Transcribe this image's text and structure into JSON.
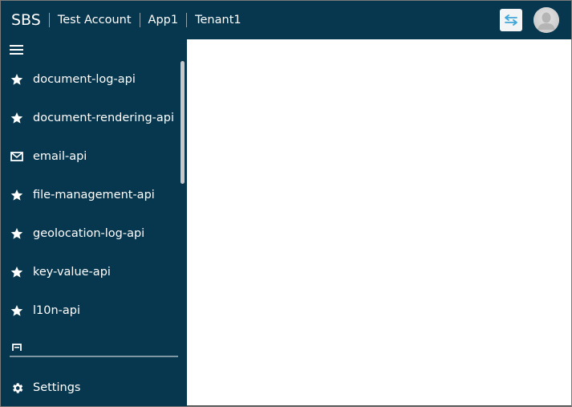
{
  "header": {
    "brand": "SBS",
    "breadcrumbs": [
      "Test Account",
      "App1",
      "Tenant1"
    ],
    "switch_icon": "swap-arrows-icon",
    "avatar_icon": "user-avatar-icon"
  },
  "sidebar": {
    "menu_icon": "hamburger-icon",
    "items": [
      {
        "label": "document-log-api",
        "icon": "star-icon"
      },
      {
        "label": "document-rendering-api",
        "icon": "star-icon"
      },
      {
        "label": "email-api",
        "icon": "envelope-icon"
      },
      {
        "label": "file-management-api",
        "icon": "star-icon"
      },
      {
        "label": "geolocation-log-api",
        "icon": "star-icon"
      },
      {
        "label": "key-value-api",
        "icon": "star-icon"
      },
      {
        "label": "l10n-api",
        "icon": "star-icon"
      },
      {
        "label": "",
        "icon": "document-icon"
      }
    ],
    "settings": {
      "label": "Settings",
      "icon": "gear-icon"
    }
  },
  "colors": {
    "header_bg": "#07374f",
    "sidebar_bg": "#07374f",
    "main_bg": "#ffffff",
    "accent": "#3fa7d9"
  }
}
